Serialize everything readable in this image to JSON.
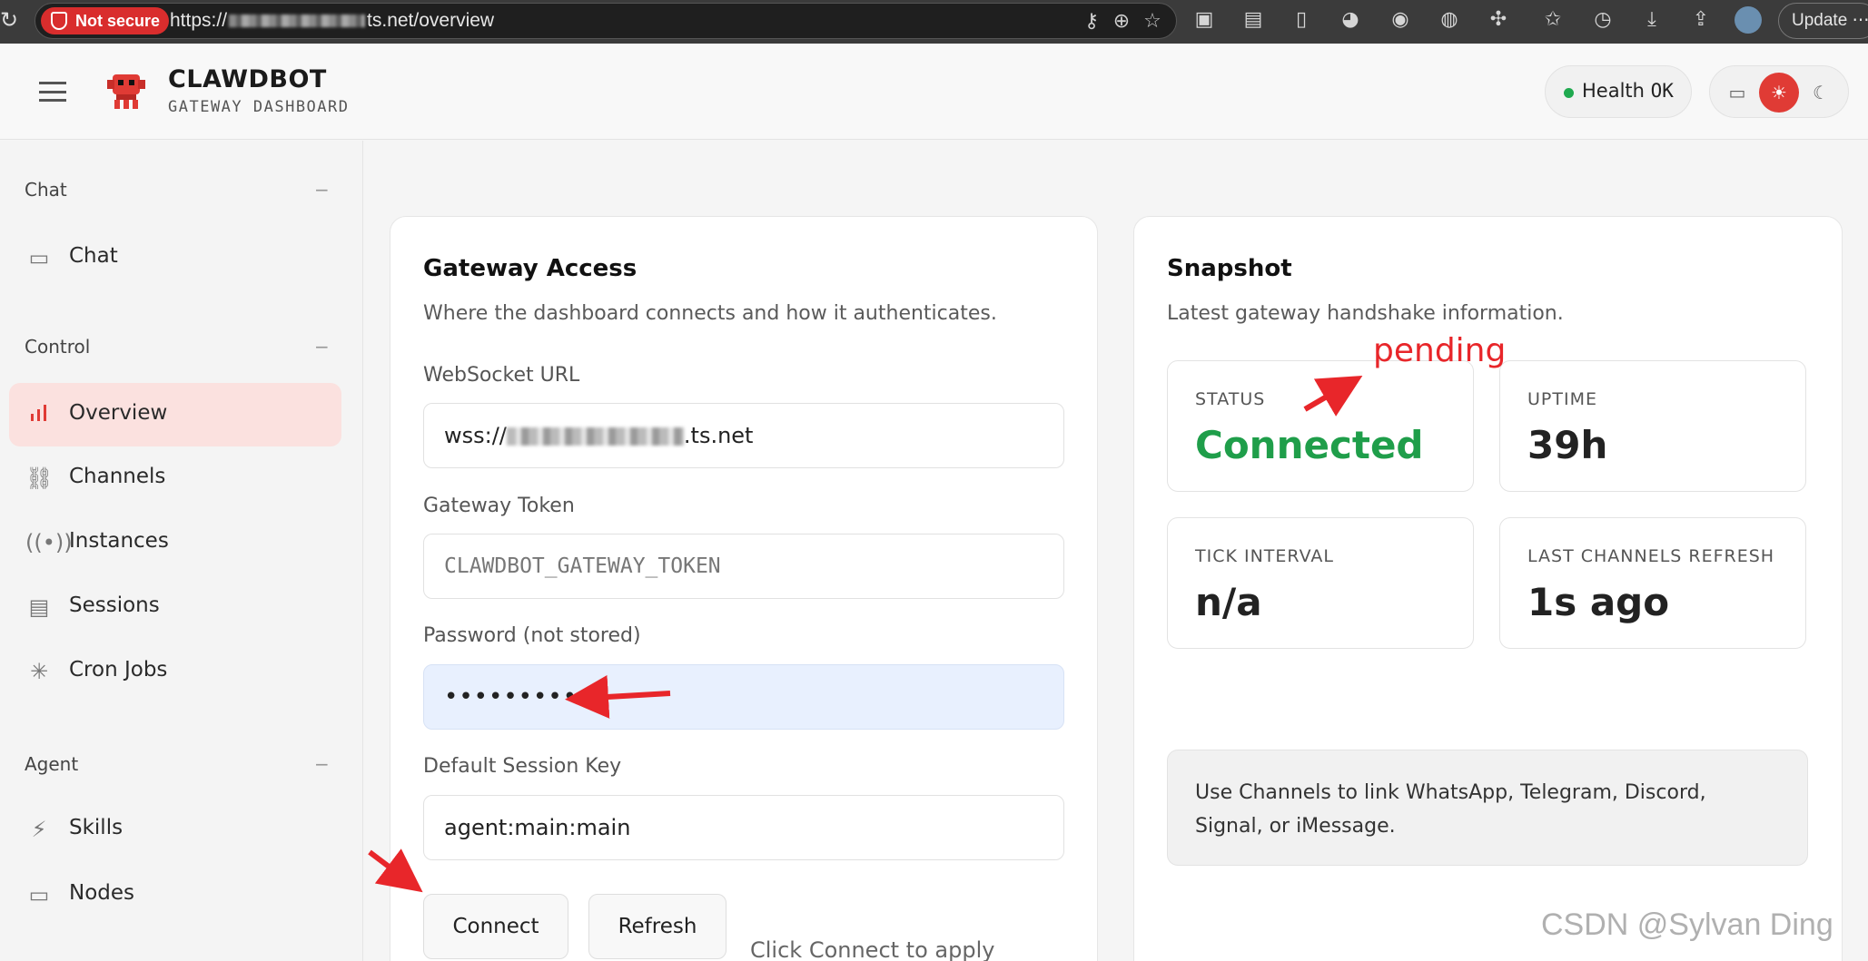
{
  "browser": {
    "security_label": "Not secure",
    "url_prefix": "https://",
    "url_suffix": "ts.net/overview",
    "update_label": "Update"
  },
  "header": {
    "brand_title": "CLAWDBOT",
    "brand_subtitle": "GATEWAY DASHBOARD",
    "health_label": "Health",
    "health_value": "OK",
    "health_color": "#1fa94f",
    "accent_color": "#e03b35"
  },
  "sidebar": {
    "groups": [
      {
        "label": "Chat",
        "collapse": "−"
      },
      {
        "label": "Control",
        "collapse": "−"
      },
      {
        "label": "Agent",
        "collapse": "−"
      }
    ],
    "items": [
      {
        "label": "Chat",
        "icon": "chat-bubble-icon"
      },
      {
        "label": "Overview",
        "icon": "bar-chart-icon",
        "active": true
      },
      {
        "label": "Channels",
        "icon": "link-icon"
      },
      {
        "label": "Instances",
        "icon": "broadcast-icon"
      },
      {
        "label": "Sessions",
        "icon": "document-icon"
      },
      {
        "label": "Cron Jobs",
        "icon": "loader-icon"
      },
      {
        "label": "Skills",
        "icon": "lightning-icon"
      },
      {
        "label": "Nodes",
        "icon": "monitor-icon"
      }
    ]
  },
  "gateway_access": {
    "title": "Gateway Access",
    "subtitle": "Where the dashboard connects and how it authenticates.",
    "websocket_label": "WebSocket URL",
    "websocket_prefix": "wss://",
    "websocket_suffix": ".ts.net",
    "token_label": "Gateway Token",
    "token_placeholder": "CLAWDBOT_GATEWAY_TOKEN",
    "password_label": "Password (not stored)",
    "password_value": "•••••••••••",
    "session_label": "Default Session Key",
    "session_value": "agent:main:main",
    "connect_label": "Connect",
    "refresh_label": "Refresh",
    "hint": "Click Connect to apply connection changes."
  },
  "snapshot": {
    "title": "Snapshot",
    "subtitle": "Latest gateway handshake information.",
    "stats": [
      {
        "label": "STATUS",
        "value": "Connected",
        "color": "#1f9e4a"
      },
      {
        "label": "UPTIME",
        "value": "39h"
      },
      {
        "label": "TICK INTERVAL",
        "value": "n/a"
      },
      {
        "label": "LAST CHANNELS REFRESH",
        "value": "1s ago"
      }
    ],
    "callout": "Use Channels to link WhatsApp, Telegram, Discord, Signal, or iMessage."
  },
  "annotations": {
    "pending_note": "pending",
    "arrow_color": "#e8262a"
  },
  "watermark": "CSDN @Sylvan Ding"
}
